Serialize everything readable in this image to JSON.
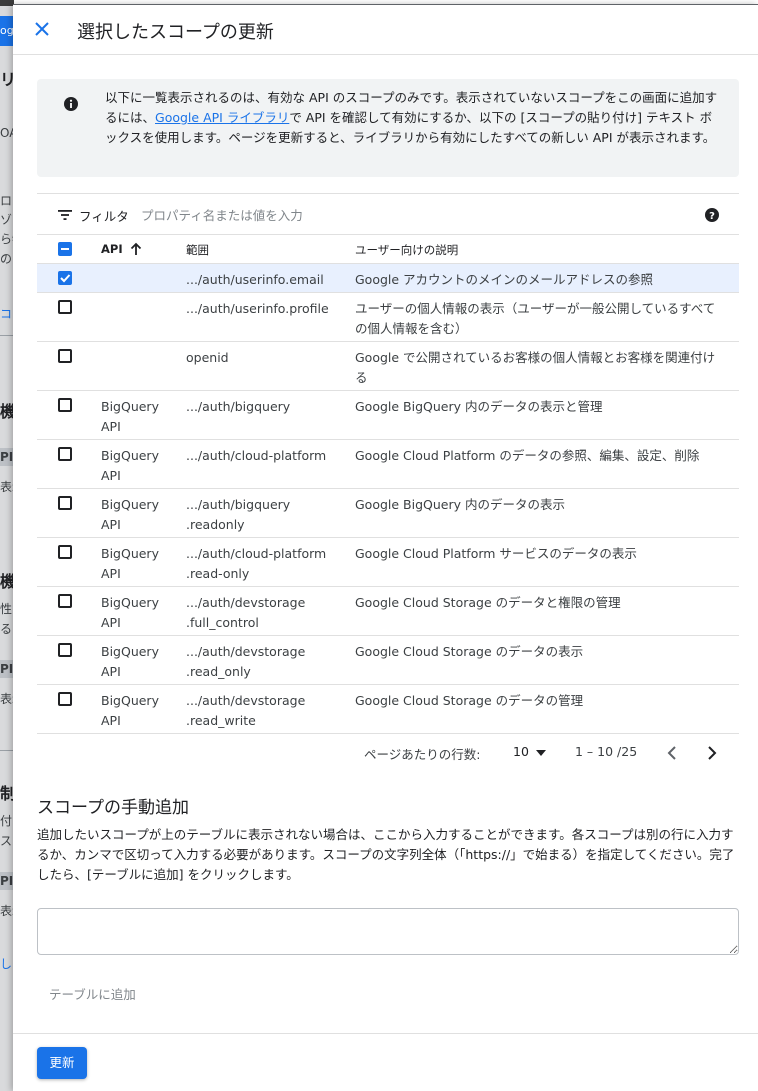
{
  "background": {
    "fragments": [
      "og",
      "リ",
      "OA",
      "ロー",
      "ゾを",
      "ら特",
      "のま",
      "コ",
      "機",
      "PI",
      "表示",
      "機",
      "性",
      "る",
      "PI",
      "表示",
      "制",
      "付",
      "ス",
      "PI",
      "表示",
      "し"
    ]
  },
  "header": {
    "title": "選択したスコープの更新"
  },
  "info": {
    "text_before": "以下に一覧表示されるのは、有効な API のスコープのみです。表示されていないスコープをこの画面に追加するには、",
    "link": "Google API ライブラリ",
    "text_after": "で API を確認して有効にするか、以下の [スコープの貼り付け] テキスト ボックスを使用します。ページを更新すると、ライブラリから有効にしたすべての新しい API が表示されます。"
  },
  "filter": {
    "label": "フィルタ",
    "placeholder": "プロパティ名または値を入力"
  },
  "table": {
    "headers": {
      "api": "API",
      "scope": "範囲",
      "desc": "ユーザー向けの説明"
    },
    "rows": [
      {
        "checked": true,
        "api": "",
        "scope": ".../auth/userinfo.email",
        "desc": "Google アカウントのメインのメールアドレスの参照"
      },
      {
        "checked": false,
        "api": "",
        "scope": ".../auth/userinfo.profile",
        "desc": "ユーザーの個人情報の表示（ユーザーが一般公開しているすべての個人情報を含む）"
      },
      {
        "checked": false,
        "api": "",
        "scope": "openid",
        "desc": "Google で公開されているお客様の個人情報とお客様を関連付ける"
      },
      {
        "checked": false,
        "api": "BigQuery API",
        "scope": ".../auth/bigquery",
        "desc": "Google BigQuery 内のデータの表示と管理"
      },
      {
        "checked": false,
        "api": "BigQuery API",
        "scope": ".../auth/cloud-platform",
        "desc": "Google Cloud Platform のデータの参照、編集、設定、削除"
      },
      {
        "checked": false,
        "api": "BigQuery API",
        "scope": ".../auth/bigquery .readonly",
        "desc": "Google BigQuery 内のデータの表示"
      },
      {
        "checked": false,
        "api": "BigQuery API",
        "scope": ".../auth/cloud-platform .read-only",
        "desc": "Google Cloud Platform サービスのデータの表示"
      },
      {
        "checked": false,
        "api": "BigQuery API",
        "scope": ".../auth/devstorage .full_control",
        "desc": "Google Cloud Storage のデータと権限の管理"
      },
      {
        "checked": false,
        "api": "BigQuery API",
        "scope": ".../auth/devstorage .read_only",
        "desc": "Google Cloud Storage のデータの表示"
      },
      {
        "checked": false,
        "api": "BigQuery API",
        "scope": ".../auth/devstorage .read_write",
        "desc": "Google Cloud Storage のデータの管理"
      }
    ]
  },
  "pager": {
    "rows_per_page_label": "ページあたりの行数:",
    "rows_per_page": "10",
    "range": "1 – 10 /25"
  },
  "manual": {
    "title": "スコープの手動追加",
    "description": "追加したいスコープが上のテーブルに表示されない場合は、ここから入力することができます。各スコープは別の行に入力するか、カンマで区切って入力する必要があります。スコープの文字列全体（「https://」で始まる）を指定してください。完了したら、[テーブルに追加] をクリックします。",
    "input_value": "",
    "add_button": "テーブルに追加"
  },
  "footer": {
    "update_button": "更新"
  },
  "colors": {
    "accent": "#1a73e8",
    "selected_row": "#e8f0fe",
    "info_bg": "#f1f3f4"
  },
  "icons": [
    "close-icon",
    "info-icon",
    "filter-icon",
    "help-icon",
    "sort-arrow-up-icon",
    "chevron-left-icon",
    "chevron-right-icon",
    "dropdown-arrow-icon"
  ]
}
